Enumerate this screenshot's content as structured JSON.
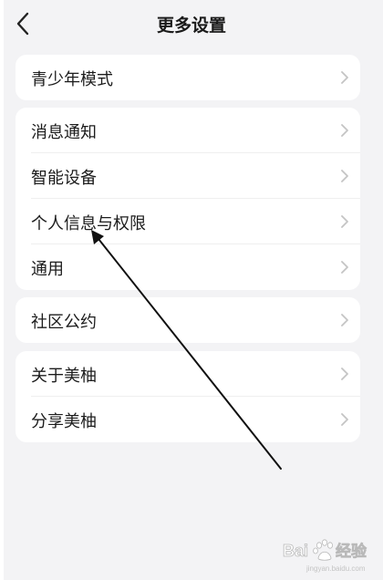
{
  "header": {
    "title": "更多设置",
    "back_icon": "chevron-left-icon"
  },
  "groups": [
    {
      "items": [
        {
          "label": "青少年模式"
        }
      ]
    },
    {
      "items": [
        {
          "label": "消息通知"
        },
        {
          "label": "智能设备"
        },
        {
          "label": "个人信息与权限"
        },
        {
          "label": "通用"
        }
      ]
    },
    {
      "items": [
        {
          "label": "社区公约"
        }
      ]
    },
    {
      "items": [
        {
          "label": "关于美柚"
        },
        {
          "label": "分享美柚"
        }
      ]
    }
  ],
  "annotation": {
    "type": "arrow",
    "color": "#111111",
    "target": "个人信息与权限"
  },
  "watermark": {
    "brand": "Baidu",
    "text": "经验",
    "subtext": "jingyan.baidu.com"
  },
  "colors": {
    "background": "#f3f3f5",
    "card": "#ffffff",
    "text": "#1c1c1c",
    "chevron": "#c4c4c4"
  }
}
